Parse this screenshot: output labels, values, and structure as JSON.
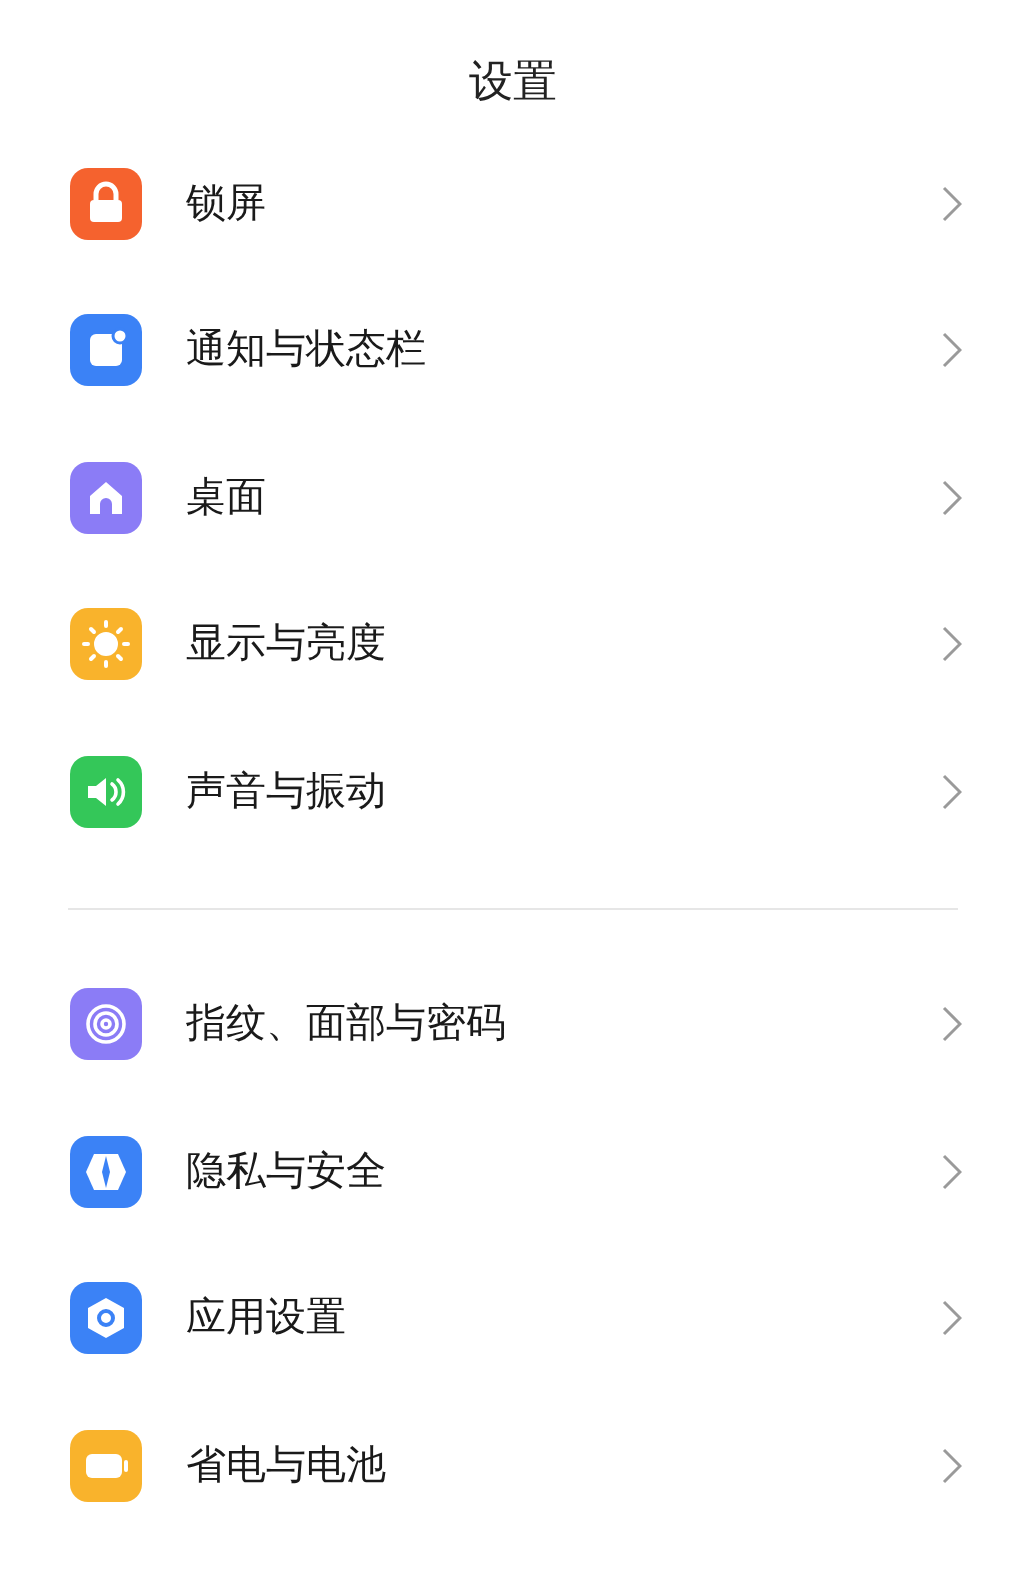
{
  "title": "设置",
  "sections": [
    {
      "items": [
        {
          "label": "锁屏",
          "kind": "lock",
          "color": "#f5622e"
        },
        {
          "label": "通知与状态栏",
          "kind": "notification",
          "color": "#3b82f6"
        },
        {
          "label": "桌面",
          "kind": "home",
          "color": "#8b7cf6"
        },
        {
          "label": "显示与亮度",
          "kind": "sun",
          "color": "#f9b32c"
        },
        {
          "label": "声音与振动",
          "kind": "sound",
          "color": "#34c759"
        }
      ]
    },
    {
      "items": [
        {
          "label": "指纹、面部与密码",
          "kind": "fingerprint",
          "color": "#8b7cf6"
        },
        {
          "label": "隐私与安全",
          "kind": "shield",
          "color": "#3b82f6"
        },
        {
          "label": "应用设置",
          "kind": "hexagon",
          "color": "#3b82f6"
        },
        {
          "label": "省电与电池",
          "kind": "battery",
          "color": "#f9b32c"
        }
      ]
    }
  ]
}
